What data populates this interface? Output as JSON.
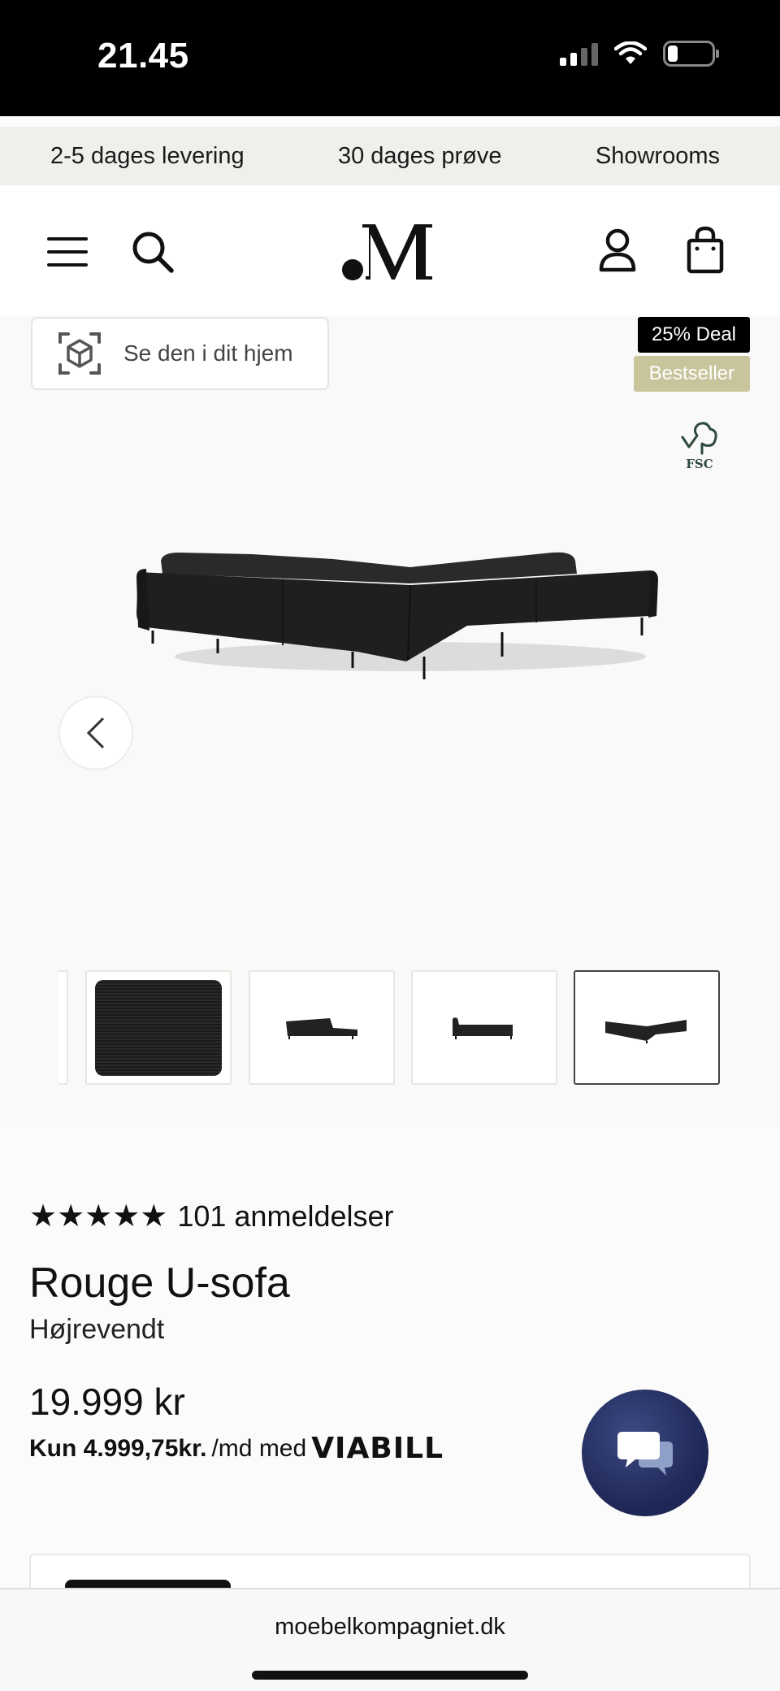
{
  "status_bar": {
    "time": "21.45"
  },
  "promo_bar": {
    "items": [
      "2-5 dages levering",
      "30 dages prøve",
      "Showrooms"
    ]
  },
  "header": {
    "logo_text": ".M"
  },
  "gallery": {
    "ar_button_label": "Se den i dit hjem",
    "badges": {
      "deal": "25% Deal",
      "bestseller": "Bestseller"
    },
    "fsc_label": "FSC",
    "thumbnails": [
      "fabric-swatch",
      "side-view",
      "front-view",
      "back-view"
    ],
    "active_thumbnail": 4
  },
  "product": {
    "stars": "★★★★★",
    "reviews": "101 anmeldelser",
    "title": "Rouge U-sofa",
    "variant": "Højrevendt",
    "price": "19.999 kr",
    "installment_amount": "Kun 4.999,75kr.",
    "installment_suffix": "/md med",
    "installment_provider": "VIABILL"
  },
  "browser": {
    "url": "moebelkompagniet.dk"
  },
  "colors": {
    "deal_badge": "#000000",
    "bestseller_badge": "#c8c49c",
    "chat_button": "#1d2654"
  }
}
